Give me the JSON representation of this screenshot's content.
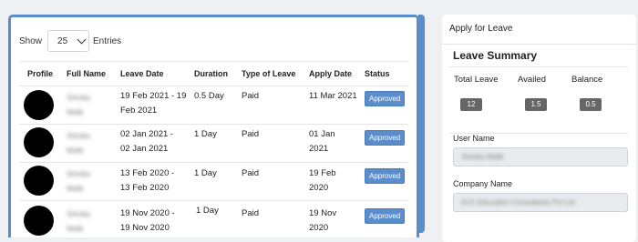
{
  "table_controls": {
    "show_label": "Show",
    "entries_value": "25",
    "entries_label": "Entries"
  },
  "table": {
    "headers": [
      "Profile",
      "Full Name",
      "Leave Date",
      "Duration",
      "Type of Leave",
      "Apply Date",
      "Status"
    ],
    "rows": [
      {
        "name_line1": "Shivika",
        "name_line2": "Malik",
        "leave_date_line1": "19 Feb 2021 - 19",
        "leave_date_line2": "Feb 2021",
        "duration": "0.5 Day",
        "type": "Paid",
        "apply_line1": "11 Mar 2021",
        "apply_line2": "",
        "status": "Approved"
      },
      {
        "name_line1": "Shivika",
        "name_line2": "Malik",
        "leave_date_line1": "02 Jan 2021 -",
        "leave_date_line2": "02 Jan 2021",
        "duration": "1 Day",
        "type": "Paid",
        "apply_line1": "01 Jan",
        "apply_line2": "2021",
        "status": "Approved"
      },
      {
        "name_line1": "Shivika",
        "name_line2": "Malik",
        "leave_date_line1": "13 Feb 2020 -",
        "leave_date_line2": "13 Feb 2020",
        "duration": "1 Day",
        "type": "Paid",
        "apply_line1": "19 Feb",
        "apply_line2": "2020",
        "status": "Approved"
      },
      {
        "name_line1": "Shivika",
        "name_line2": "Malik",
        "leave_date_line1": "19 Nov 2020 -",
        "leave_date_line2": "19 Nov 2020",
        "duration": "1 Day",
        "type": "Paid",
        "apply_line1": "19 Nov",
        "apply_line2": "2020",
        "status": "Approved"
      }
    ]
  },
  "apply_panel": {
    "header": "Apply for Leave",
    "summary_title": "Leave Summary",
    "summary": {
      "total_label": "Total Leave",
      "total_value": "12",
      "availed_label": "Availed",
      "availed_value": "1.5",
      "balance_label": "Balance",
      "balance_value": "0.5"
    },
    "user_name_label": "User Name",
    "user_name_value": "Shivika Malik",
    "company_name_label": "Company Name",
    "company_name_value": "ELK Education Consultants Pvt Ltd"
  },
  "colors": {
    "accent": "#5b8dcb",
    "badge": "#5b8dcb",
    "pill": "#666666"
  }
}
